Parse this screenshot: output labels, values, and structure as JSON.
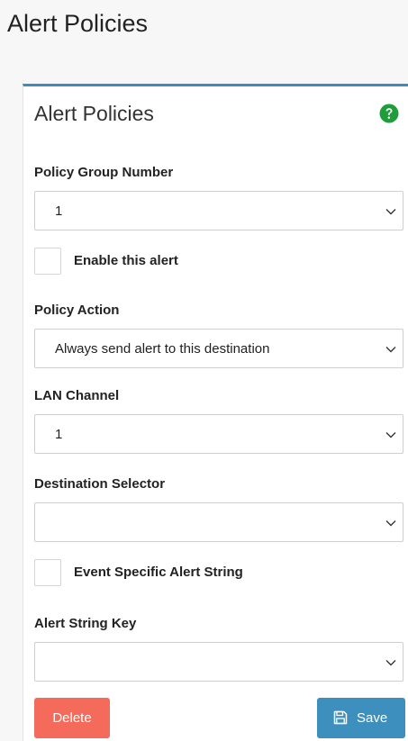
{
  "page": {
    "title": "Alert Policies"
  },
  "card": {
    "title": "Alert Policies",
    "help_icon": "question-circle-icon",
    "accent_color": "#3c8dbc"
  },
  "form": {
    "policy_group_number": {
      "label": "Policy Group Number",
      "value": "1"
    },
    "enable_alert": {
      "label": "Enable this alert",
      "checked": false
    },
    "policy_action": {
      "label": "Policy Action",
      "value": "Always send alert to this destination"
    },
    "lan_channel": {
      "label": "LAN Channel",
      "value": "1"
    },
    "destination_selector": {
      "label": "Destination Selector",
      "value": ""
    },
    "event_specific": {
      "label": "Event Specific Alert String",
      "checked": false
    },
    "alert_string_key": {
      "label": "Alert String Key",
      "value": ""
    }
  },
  "buttons": {
    "delete_label": "Delete",
    "delete_color": "#f56b5b",
    "save_label": "Save",
    "save_color": "#3d8fbd",
    "save_icon": "floppy-disk-icon"
  }
}
